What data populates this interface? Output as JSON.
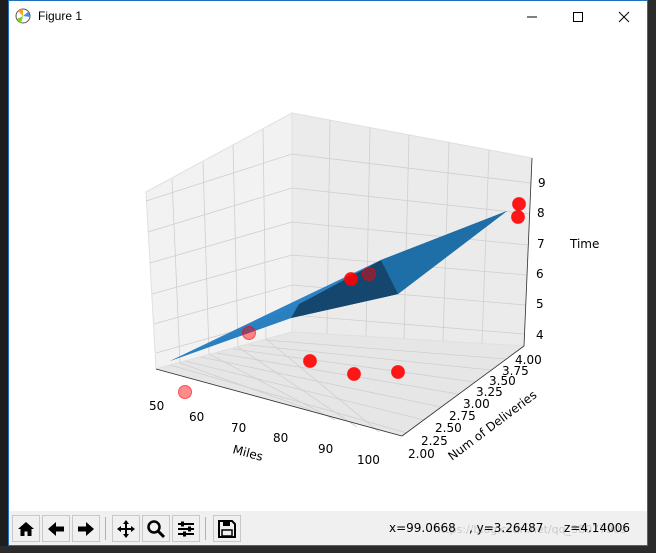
{
  "window": {
    "title": "Figure 1",
    "controls": [
      "minimize",
      "maximize",
      "close"
    ]
  },
  "chart_data": {
    "type": "scatter",
    "subtype": "3d-scatter-with-regression-plane",
    "xlabel": "Miles",
    "ylabel": "Num of Deliveries",
    "zlabel": "Time",
    "x_ticks": [
      "50",
      "60",
      "70",
      "80",
      "90",
      "100"
    ],
    "y_ticks": [
      "2.00",
      "2.25",
      "2.50",
      "2.75",
      "3.00",
      "3.25",
      "3.50",
      "3.75",
      "4.00"
    ],
    "z_ticks": [
      "4",
      "5",
      "6",
      "7",
      "8",
      "9"
    ],
    "xlim": [
      50,
      100
    ],
    "ylim": [
      2,
      4
    ],
    "zlim": [
      4,
      9.5
    ],
    "grid": true,
    "points": [
      {
        "x": 100,
        "y": 4,
        "z": 9.3
      },
      {
        "x": 100,
        "y": 4,
        "z": 8.9
      },
      {
        "x": 50,
        "y": 2,
        "z": 4.8
      },
      {
        "x": 60,
        "y": 3,
        "z": 6.8
      },
      {
        "x": 100,
        "y": 2,
        "z": 6.2
      },
      {
        "x": 80,
        "y": 3,
        "z": 7.6
      },
      {
        "x": 50,
        "y": 3,
        "z": 6.2
      },
      {
        "x": 80,
        "y": 2,
        "z": 7.4
      },
      {
        "x": 90,
        "y": 2,
        "z": 6.4
      }
    ],
    "point_color": "#ff0000",
    "surface_color": "#1f77b4"
  },
  "toolbar": {
    "buttons": [
      "home-icon",
      "back-icon",
      "forward-icon",
      "pan-icon",
      "zoom-icon",
      "configure-subplots-icon",
      "save-icon"
    ],
    "coord_x": "x=99.0668",
    "coord_y": ", y=3.26487",
    "coord_z": "z=4.14006",
    "watermark": "https://blog.csdn.net/qq_38077909"
  }
}
